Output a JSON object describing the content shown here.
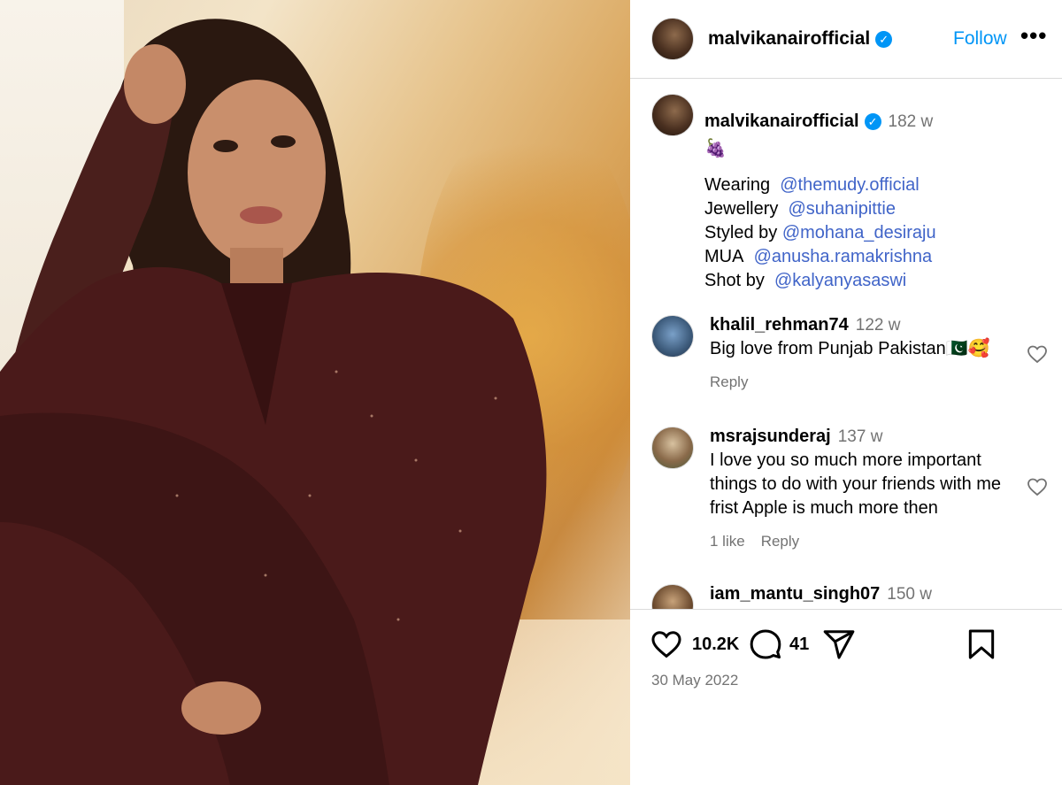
{
  "post": {
    "username": "malvikanairofficial",
    "follow_label": "Follow",
    "more_label": "•••",
    "verified_mark": "✓"
  },
  "caption": {
    "username": "malvikanairofficial",
    "time": "182 w",
    "emoji": "🍇",
    "lines": [
      {
        "prefix": "Wearing",
        "mention": "@themudy.official"
      },
      {
        "prefix": "Jewellery",
        "mention": "@suhanipittie"
      },
      {
        "prefix": "Styled by",
        "mention": "@mohana_desiraju"
      },
      {
        "prefix": "MUA",
        "mention": "@anusha.ramakrishna"
      },
      {
        "prefix": "Shot by",
        "mention": "@kalyanyasaswi"
      }
    ]
  },
  "comments": [
    {
      "username": "khalil_rehman74",
      "time": "122 w",
      "text": "Big love from Punjab Pakistan🇵🇰🥰",
      "likes": "",
      "reply_label": "Reply"
    },
    {
      "username": "msrajsunderaj",
      "time": "137 w",
      "text": "I love you so much more important things to do with your friends with me frist Apple is much more then",
      "likes": "1 like",
      "reply_label": "Reply"
    },
    {
      "username": "iam_mantu_singh07",
      "time": "150 w",
      "text": "",
      "likes": "",
      "reply_label": ""
    }
  ],
  "actions": {
    "like_count": "10.2K",
    "comment_count": "41",
    "date": "30 May 2022",
    "icons": [
      "heart-icon",
      "comment-icon",
      "share-icon",
      "bookmark-icon"
    ]
  },
  "colors": {
    "link": "#4064c8",
    "follow": "#0095f6",
    "muted": "#737373"
  }
}
